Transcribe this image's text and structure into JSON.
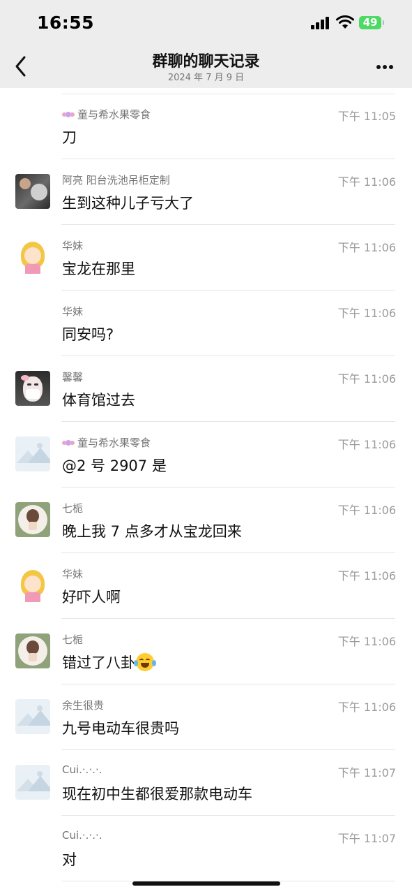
{
  "status_bar": {
    "time": "16:55",
    "battery": "49"
  },
  "header": {
    "title": "群聊的聊天记录",
    "date": "2024 年 7 月 9 日"
  },
  "messages": [
    {
      "sender": "童与希水果零食",
      "time": "下午 11:05",
      "text": "刀",
      "avatar": "none",
      "sender_icon": "candy-icon"
    },
    {
      "sender": "阿亮 阳台洗池吊柜定制",
      "time": "下午 11:06",
      "text": "生到这种儿子亏大了",
      "avatar": "dark-photo"
    },
    {
      "sender": "华妹",
      "time": "下午 11:06",
      "text": "宝龙在那里",
      "avatar": "cartoon-girl"
    },
    {
      "sender": "华妹",
      "time": "下午 11:06",
      "text": "同安吗?",
      "avatar": "none"
    },
    {
      "sender": "馨馨",
      "time": "下午 11:06",
      "text": "体育馆过去",
      "avatar": "masked-girl"
    },
    {
      "sender": "童与希水果零食",
      "time": "下午 11:06",
      "text": "@2 号 2907 是",
      "avatar": "placeholder",
      "sender_icon": "candy-icon"
    },
    {
      "sender": "七栀",
      "time": "下午 11:06",
      "text": "晚上我 7 点多才从宝龙回来",
      "avatar": "hair-bun"
    },
    {
      "sender": "华妹",
      "time": "下午 11:06",
      "text": "好吓人啊",
      "avatar": "cartoon-girl"
    },
    {
      "sender": "七栀",
      "time": "下午 11:06",
      "text": "错过了八卦",
      "avatar": "hair-bun",
      "trailing_emoji": "laughing-crying-emoji"
    },
    {
      "sender": "余生很贵",
      "time": "下午 11:06",
      "text": "九号电动车很贵吗",
      "avatar": "placeholder"
    },
    {
      "sender": "Cui.·.·.·.",
      "time": "下午 11:07",
      "text": "现在初中生都很爱那款电动车",
      "avatar": "placeholder"
    },
    {
      "sender": "Cui.·.·.·.",
      "time": "下午 11:07",
      "text": "对",
      "avatar": "none"
    }
  ]
}
